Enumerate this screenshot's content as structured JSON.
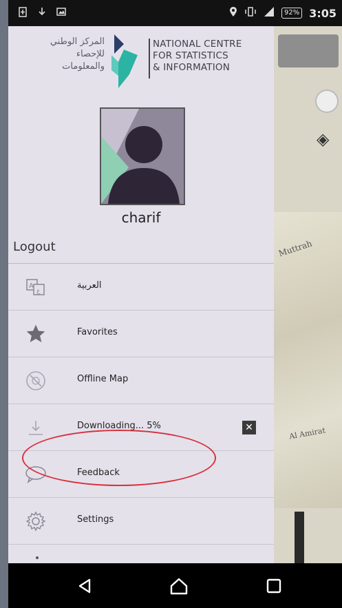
{
  "status_bar": {
    "left_icons": [
      "battery-saver-icon",
      "download-icon",
      "image-icon"
    ],
    "right_icons": [
      "location-icon",
      "vibrate-icon",
      "signal-icon"
    ],
    "battery": "92%",
    "time": "3:05"
  },
  "logo": {
    "arabic_line1": "المركز الوطني",
    "arabic_line2": "للإحصاء",
    "arabic_line3": "والمعلومات",
    "english_line1": "NATIONAL CENTRE",
    "english_line2": "FOR STATISTICS",
    "english_line3": "& INFORMATION"
  },
  "profile": {
    "username": "charif",
    "logout_label": "Logout"
  },
  "menu": [
    {
      "label": "العربية",
      "icon": "translate-icon"
    },
    {
      "label": "Favorites",
      "icon": "star-icon"
    },
    {
      "label": "Offline Map",
      "icon": "offline-icon"
    },
    {
      "label": "Downloading... 5%",
      "icon": "download-progress-icon",
      "progress_percent": 5
    },
    {
      "label": "Feedback",
      "icon": "chat-bubble-icon"
    },
    {
      "label": "Settings",
      "icon": "gear-icon"
    }
  ],
  "map": {
    "label1": "Muttrah",
    "label2": "Al Amirat"
  },
  "nav_bar": {
    "icons": [
      "back-icon",
      "home-icon",
      "recents-icon"
    ]
  },
  "colors": {
    "drawer_bg": "#e5e1eb",
    "annotation_red": "#d6323c",
    "logo_teal": "#2bb3a3",
    "logo_navy": "#2b3e6b"
  }
}
